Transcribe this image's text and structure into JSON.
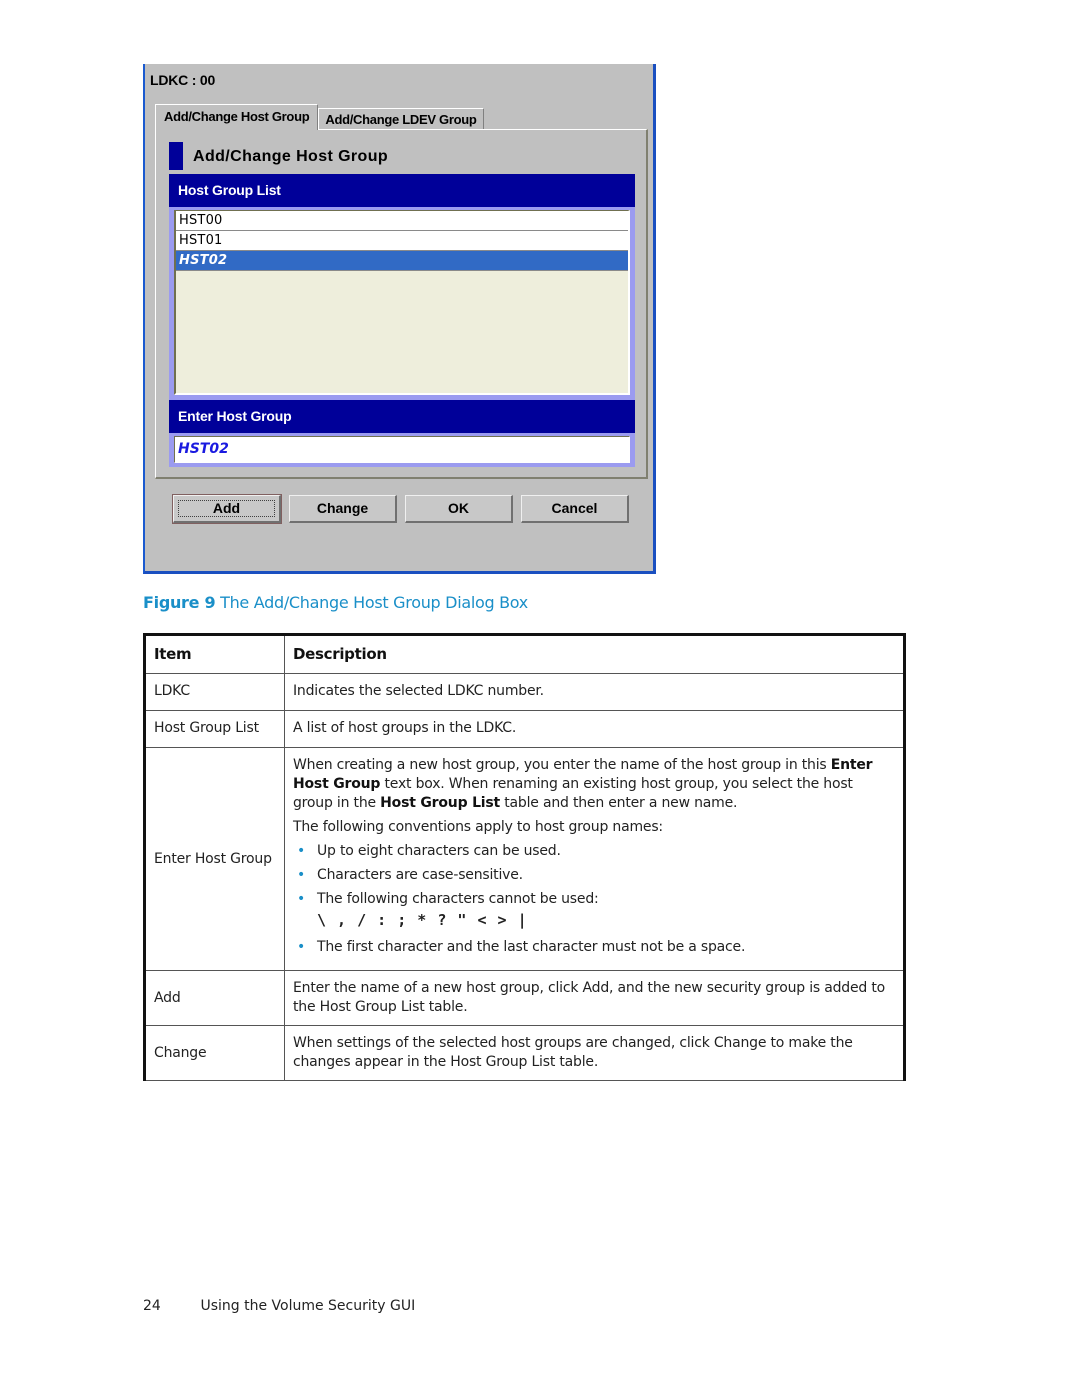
{
  "dialog": {
    "ldkc_label": "LDKC : 00",
    "tabs": [
      {
        "label": "Add/Change Host Group",
        "active": true
      },
      {
        "label": "Add/Change LDEV Group",
        "active": false
      }
    ],
    "section_title": "Add/Change Host Group",
    "host_group_list": {
      "header": "Host Group List",
      "items": [
        {
          "label": "HST00",
          "selected": false
        },
        {
          "label": "HST01",
          "selected": false
        },
        {
          "label": "HST02",
          "selected": true
        }
      ]
    },
    "enter_host_group": {
      "header": "Enter Host Group",
      "value": "HST02"
    },
    "buttons": {
      "add": "Add",
      "change": "Change",
      "ok": "OK",
      "cancel": "Cancel"
    },
    "colors": {
      "band": "#000099",
      "selection": "#316ac5",
      "input_text": "#1a1ae0",
      "panel": "#c0c0c0",
      "list_background": "#eeeedc"
    }
  },
  "caption": {
    "figure_label": "Figure 9",
    "title": "The Add/Change Host Group Dialog Box",
    "color": "#1a8fc8"
  },
  "table": {
    "headers": {
      "item": "Item",
      "description": "Description"
    },
    "rows": [
      {
        "item": "LDKC",
        "description": "Indicates the selected LDKC number."
      },
      {
        "item": "Host Group List",
        "description": "A list of host groups in the LDKC."
      },
      {
        "item": "Enter Host Group",
        "description_parts": {
          "p1_a": "When creating a new host group, you enter the name of the host group in this ",
          "p1_b": "Enter Host Group",
          "p1_c": " text box. When renaming an existing host group, you select the host group in the ",
          "p1_d": "Host Group List",
          "p1_e": " table and then enter a new name.",
          "p2": "The following conventions apply to host group names:",
          "bullets": [
            "Up to eight characters can be used.",
            "Characters are case-sensitive.",
            "The following characters cannot be used:",
            "The first character and the last character must not be a space."
          ],
          "forbidden_chars": "\\ , / : ; * ? \" < > |",
          "bullet_glyph": "•"
        }
      },
      {
        "item": "Add",
        "description": "Enter the name of a new host group, click Add, and the new security group is added to the Host Group List table."
      },
      {
        "item": "Change",
        "description": "When settings of the selected host groups are changed, click Change to make the changes appear in the Host Group List table."
      }
    ]
  },
  "footer": {
    "page_number": "24",
    "section": "Using the Volume Security GUI"
  }
}
